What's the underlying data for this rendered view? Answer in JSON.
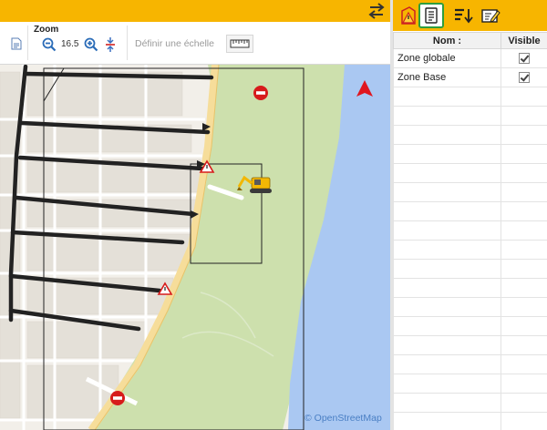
{
  "ribbon": {
    "zoom_group_label": "Zoom",
    "zoom_value": "16.5",
    "define_scale_label": "Définir une échelle"
  },
  "map": {
    "attribution": "© OpenStreetMap",
    "colors": {
      "land": "#f2efe9",
      "park": "#cde0ad",
      "water": "#aac8f2",
      "road_major": "#f6dd9a",
      "route": "#222222",
      "north_arrow": "#e0161f",
      "no_entry": "#d71b1b",
      "excavator": "#f2b705"
    },
    "icons": [
      "north-arrow-icon",
      "no-entry-sign-icon",
      "roadwork-warning-icon",
      "excavator-icon"
    ]
  },
  "layers_panel": {
    "toolbar_icons": [
      "zone-warning-icon",
      "layers-table-icon",
      "sort-icon",
      "edit-layer-icon"
    ],
    "columns": {
      "name": "Nom :",
      "visible": "Visible"
    },
    "rows": [
      {
        "name": "Zone globale",
        "visible": true
      },
      {
        "name": "Zone Base",
        "visible": true
      }
    ],
    "empty_rows": 18
  },
  "theme": {
    "accent": "#f7b500",
    "selection_border": "#2e9e3e"
  }
}
